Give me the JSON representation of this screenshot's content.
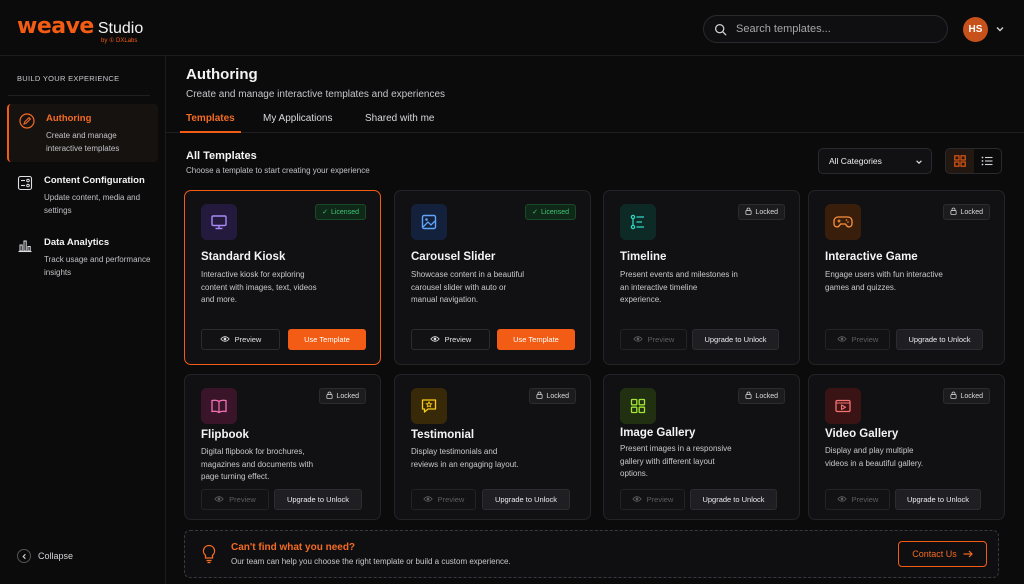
{
  "brand": {
    "name": "weave",
    "product": "Studio",
    "byline": "by ① DXLabs"
  },
  "search": {
    "placeholder": "Search templates..."
  },
  "user": {
    "initials": "HS"
  },
  "sidebar": {
    "section_label": "BUILD YOUR EXPERIENCE",
    "items": [
      {
        "title": "Authoring",
        "desc": "Create and manage interactive templates",
        "icon": "pen-icon"
      },
      {
        "title": "Content Configuration",
        "desc": "Update content, media and settings",
        "icon": "config-icon"
      },
      {
        "title": "Data Analytics",
        "desc": "Track usage and performance insights",
        "icon": "chart-icon"
      }
    ],
    "collapse_label": "Collapse"
  },
  "page": {
    "title": "Authoring",
    "subtitle": "Create and manage interactive templates and experiences"
  },
  "tabs": [
    {
      "label": "Templates"
    },
    {
      "label": "My Applications"
    },
    {
      "label": "Shared with me"
    }
  ],
  "section": {
    "title": "All Templates",
    "subtitle": "Choose a template to start creating your experience",
    "category_selected": "All Categories"
  },
  "cards": [
    {
      "title": "Standard Kiosk",
      "desc": "Interactive kiosk for exploring content with images, text, videos and more.",
      "badge": "Licensed",
      "preview": "Preview",
      "action": "Use Template",
      "icon": "monitor-icon",
      "color": "#8b5cf6"
    },
    {
      "title": "Carousel Slider",
      "desc": "Showcase content in a beautiful carousel slider with auto or manual navigation.",
      "badge": "Licensed",
      "preview": "Preview",
      "action": "Use Template",
      "icon": "image-icon",
      "color": "#3b82f6"
    },
    {
      "title": "Timeline",
      "desc": "Present events and milestones in an interactive timeline experience.",
      "badge": "Locked",
      "preview": "Preview",
      "action": "Upgrade to Unlock",
      "icon": "timeline-icon",
      "color": "#14b8a6"
    },
    {
      "title": "Interactive Game",
      "desc": "Engage users with fun interactive games and quizzes.",
      "badge": "Locked",
      "preview": "Preview",
      "action": "Upgrade to Unlock",
      "icon": "gamepad-icon",
      "color": "#f97316"
    },
    {
      "title": "Flipbook",
      "desc": "Digital flipbook for brochures, magazines and documents with page turning effect.",
      "badge": "Locked",
      "preview": "Preview",
      "action": "Upgrade to Unlock",
      "icon": "book-icon",
      "color": "#ec4899"
    },
    {
      "title": "Testimonial",
      "desc": "Display testimonials and reviews in an engaging layout.",
      "badge": "Locked",
      "preview": "Preview",
      "action": "Upgrade to Unlock",
      "icon": "star-message-icon",
      "color": "#eab308"
    },
    {
      "title": "Image Gallery",
      "desc": "Present images in a responsive gallery with different layout options.",
      "badge": "Locked",
      "preview": "Preview",
      "action": "Upgrade to Unlock",
      "icon": "grid-icon",
      "color": "#84cc16"
    },
    {
      "title": "Video Gallery",
      "desc": "Display and play multiple videos in a beautiful gallery.",
      "badge": "Locked",
      "preview": "Preview",
      "action": "Upgrade to Unlock",
      "icon": "video-icon",
      "color": "#ef4444"
    }
  ],
  "help": {
    "title": "Can't find what you need?",
    "desc": "Our team can help you choose the right template or build a custom experience.",
    "button": "Contact Us"
  },
  "colors": {
    "accent": "#f25c14",
    "licensed": "#3ec775"
  }
}
